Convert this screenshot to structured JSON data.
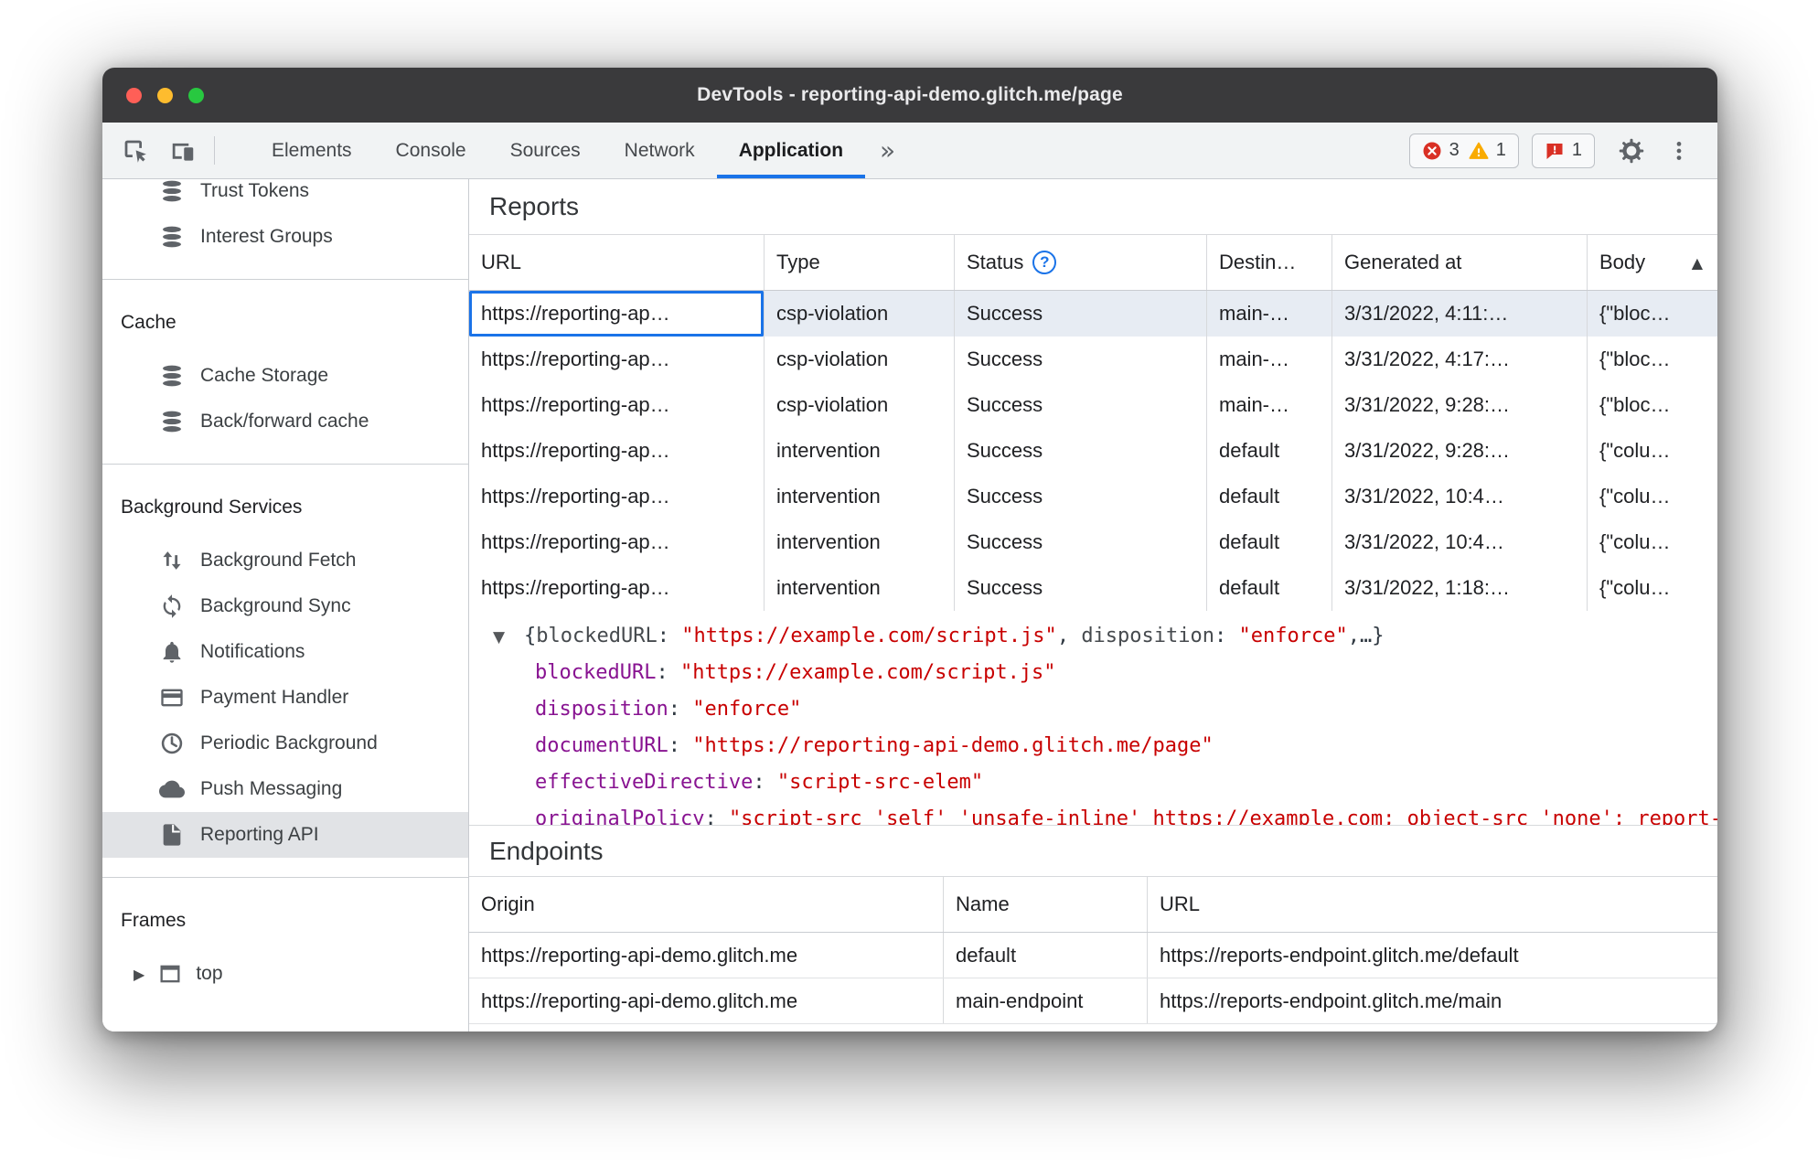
{
  "window": {
    "title": "DevTools - reporting-api-demo.glitch.me/page",
    "controls": [
      "close",
      "minimize",
      "zoom"
    ]
  },
  "toolbar": {
    "tabs": [
      "Elements",
      "Console",
      "Sources",
      "Network",
      "Application"
    ],
    "selected_tab": "Application",
    "more_tabs_glyph": "»",
    "badges": {
      "errors": "3",
      "warnings": "1",
      "issues": "1"
    },
    "icons": [
      "inspect-element-icon",
      "device-toolbar-icon",
      "error-icon",
      "warning-icon",
      "issues-icon",
      "settings-gear-icon",
      "more-menu-icon"
    ]
  },
  "sidebar": {
    "top_items": [
      {
        "label": "Trust Tokens",
        "icon": "database-icon"
      },
      {
        "label": "Interest Groups",
        "icon": "database-icon"
      }
    ],
    "cache": {
      "header": "Cache",
      "items": [
        {
          "label": "Cache Storage",
          "icon": "database-icon"
        },
        {
          "label": "Back/forward cache",
          "icon": "database-icon"
        }
      ]
    },
    "background_services": {
      "header": "Background Services",
      "items": [
        {
          "label": "Background Fetch",
          "icon": "fetch-arrows-icon"
        },
        {
          "label": "Background Sync",
          "icon": "sync-icon"
        },
        {
          "label": "Notifications",
          "icon": "bell-icon"
        },
        {
          "label": "Payment Handler",
          "icon": "credit-card-icon"
        },
        {
          "label": "Periodic Background",
          "icon": "clock-icon"
        },
        {
          "label": "Push Messaging",
          "icon": "cloud-icon"
        },
        {
          "label": "Reporting API",
          "icon": "document-icon",
          "selected": true
        }
      ]
    },
    "frames": {
      "header": "Frames",
      "items": [
        {
          "label": "top",
          "icon": "frame-icon",
          "expander": "▶"
        }
      ]
    }
  },
  "reports": {
    "title": "Reports",
    "columns": {
      "url": "URL",
      "type": "Type",
      "status": "Status",
      "destination": "Destin…",
      "generated_at": "Generated at",
      "body": "Body"
    },
    "status_help_glyph": "?",
    "sort_ascending_glyph": "▲",
    "rows": [
      {
        "url": "https://reporting-ap…",
        "type": "csp-violation",
        "status": "Success",
        "destination": "main-…",
        "generated_at": "3/31/2022, 4:11:…",
        "body": "{\"bloc…"
      },
      {
        "url": "https://reporting-ap…",
        "type": "csp-violation",
        "status": "Success",
        "destination": "main-…",
        "generated_at": "3/31/2022, 4:17:…",
        "body": "{\"bloc…"
      },
      {
        "url": "https://reporting-ap…",
        "type": "csp-violation",
        "status": "Success",
        "destination": "main-…",
        "generated_at": "3/31/2022, 9:28:…",
        "body": "{\"bloc…"
      },
      {
        "url": "https://reporting-ap…",
        "type": "intervention",
        "status": "Success",
        "destination": "default",
        "generated_at": "3/31/2022, 9:28:…",
        "body": "{\"colu…"
      },
      {
        "url": "https://reporting-ap…",
        "type": "intervention",
        "status": "Success",
        "destination": "default",
        "generated_at": "3/31/2022, 10:4…",
        "body": "{\"colu…"
      },
      {
        "url": "https://reporting-ap…",
        "type": "intervention",
        "status": "Success",
        "destination": "default",
        "generated_at": "3/31/2022, 10:4…",
        "body": "{\"colu…"
      },
      {
        "url": "https://reporting-ap…",
        "type": "intervention",
        "status": "Success",
        "destination": "default",
        "generated_at": "3/31/2022, 1:18:…",
        "body": "{\"colu…"
      }
    ]
  },
  "detail": {
    "expander_glyph": "▼",
    "preview": {
      "open": "{",
      "key1": "blockedURL",
      "sep1": ": ",
      "val1": "\"https://example.com/script.js\"",
      "comma": ", ",
      "key2": "disposition",
      "sep2": ": ",
      "val2": "\"enforce\"",
      "tail": ",…}"
    },
    "properties": [
      {
        "key": "blockedURL",
        "sep": ": ",
        "value": "\"https://example.com/script.js\""
      },
      {
        "key": "disposition",
        "sep": ": ",
        "value": "\"enforce\""
      },
      {
        "key": "documentURL",
        "sep": ": ",
        "value": "\"https://reporting-api-demo.glitch.me/page\""
      },
      {
        "key": "effectiveDirective",
        "sep": ": ",
        "value": "\"script-src-elem\""
      },
      {
        "key": "originalPolicy",
        "sep": ": ",
        "value": "\"script-src 'self' 'unsafe-inline' https://example.com; object-src 'none'; report-to main-endpoint\""
      }
    ]
  },
  "endpoints": {
    "title": "Endpoints",
    "columns": {
      "origin": "Origin",
      "name": "Name",
      "url": "URL"
    },
    "rows": [
      {
        "origin": "https://reporting-api-demo.glitch.me",
        "name": "default",
        "url": "https://reports-endpoint.glitch.me/default"
      },
      {
        "origin": "https://reporting-api-demo.glitch.me",
        "name": "main-endpoint",
        "url": "https://reports-endpoint.glitch.me/main"
      }
    ]
  },
  "colors": {
    "accent_blue": "#1a73e8",
    "error_red": "#d93025",
    "warning_amber": "#f9ab00",
    "json_key_magenta": "#881391",
    "json_string_red": "#c80000",
    "selected_row": "#e7ecf3",
    "sidebar_selected": "#e1e3e6",
    "titlebar": "#3a3a3c"
  }
}
